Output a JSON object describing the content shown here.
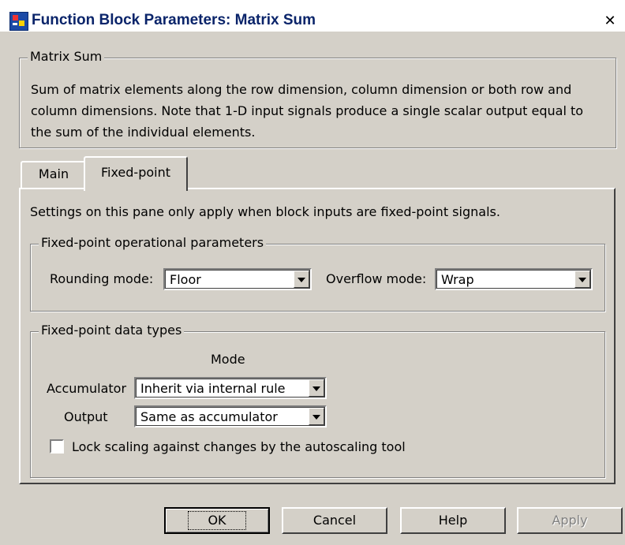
{
  "window": {
    "title": "Function Block Parameters: Matrix Sum",
    "close_glyph": "✕",
    "app_icon": "simulink-block-icon"
  },
  "description_group": {
    "title": "Matrix Sum",
    "text": "Sum of matrix elements along the row dimension, column dimension or both row and column dimensions. Note that 1-D input signals produce a single scalar output equal to the sum of the individual elements."
  },
  "tabs": [
    {
      "label": "Main",
      "active": false
    },
    {
      "label": "Fixed-point",
      "active": true
    }
  ],
  "fixed_point_pane": {
    "note": "Settings on this pane only apply when block inputs are fixed-point signals.",
    "operational": {
      "title": "Fixed-point operational parameters",
      "rounding_label": "Rounding mode:",
      "rounding_value": "Floor",
      "overflow_label": "Overflow mode:",
      "overflow_value": "Wrap"
    },
    "data_types": {
      "title": "Fixed-point data types",
      "mode_header": "Mode",
      "accumulator_label": "Accumulator",
      "accumulator_value": "Inherit via internal rule",
      "output_label": "Output",
      "output_value": "Same as accumulator",
      "lock_scaling_label": "Lock scaling against changes by the autoscaling tool",
      "lock_scaling_checked": false
    }
  },
  "buttons": {
    "ok": "OK",
    "cancel": "Cancel",
    "help": "Help",
    "apply": "Apply"
  }
}
